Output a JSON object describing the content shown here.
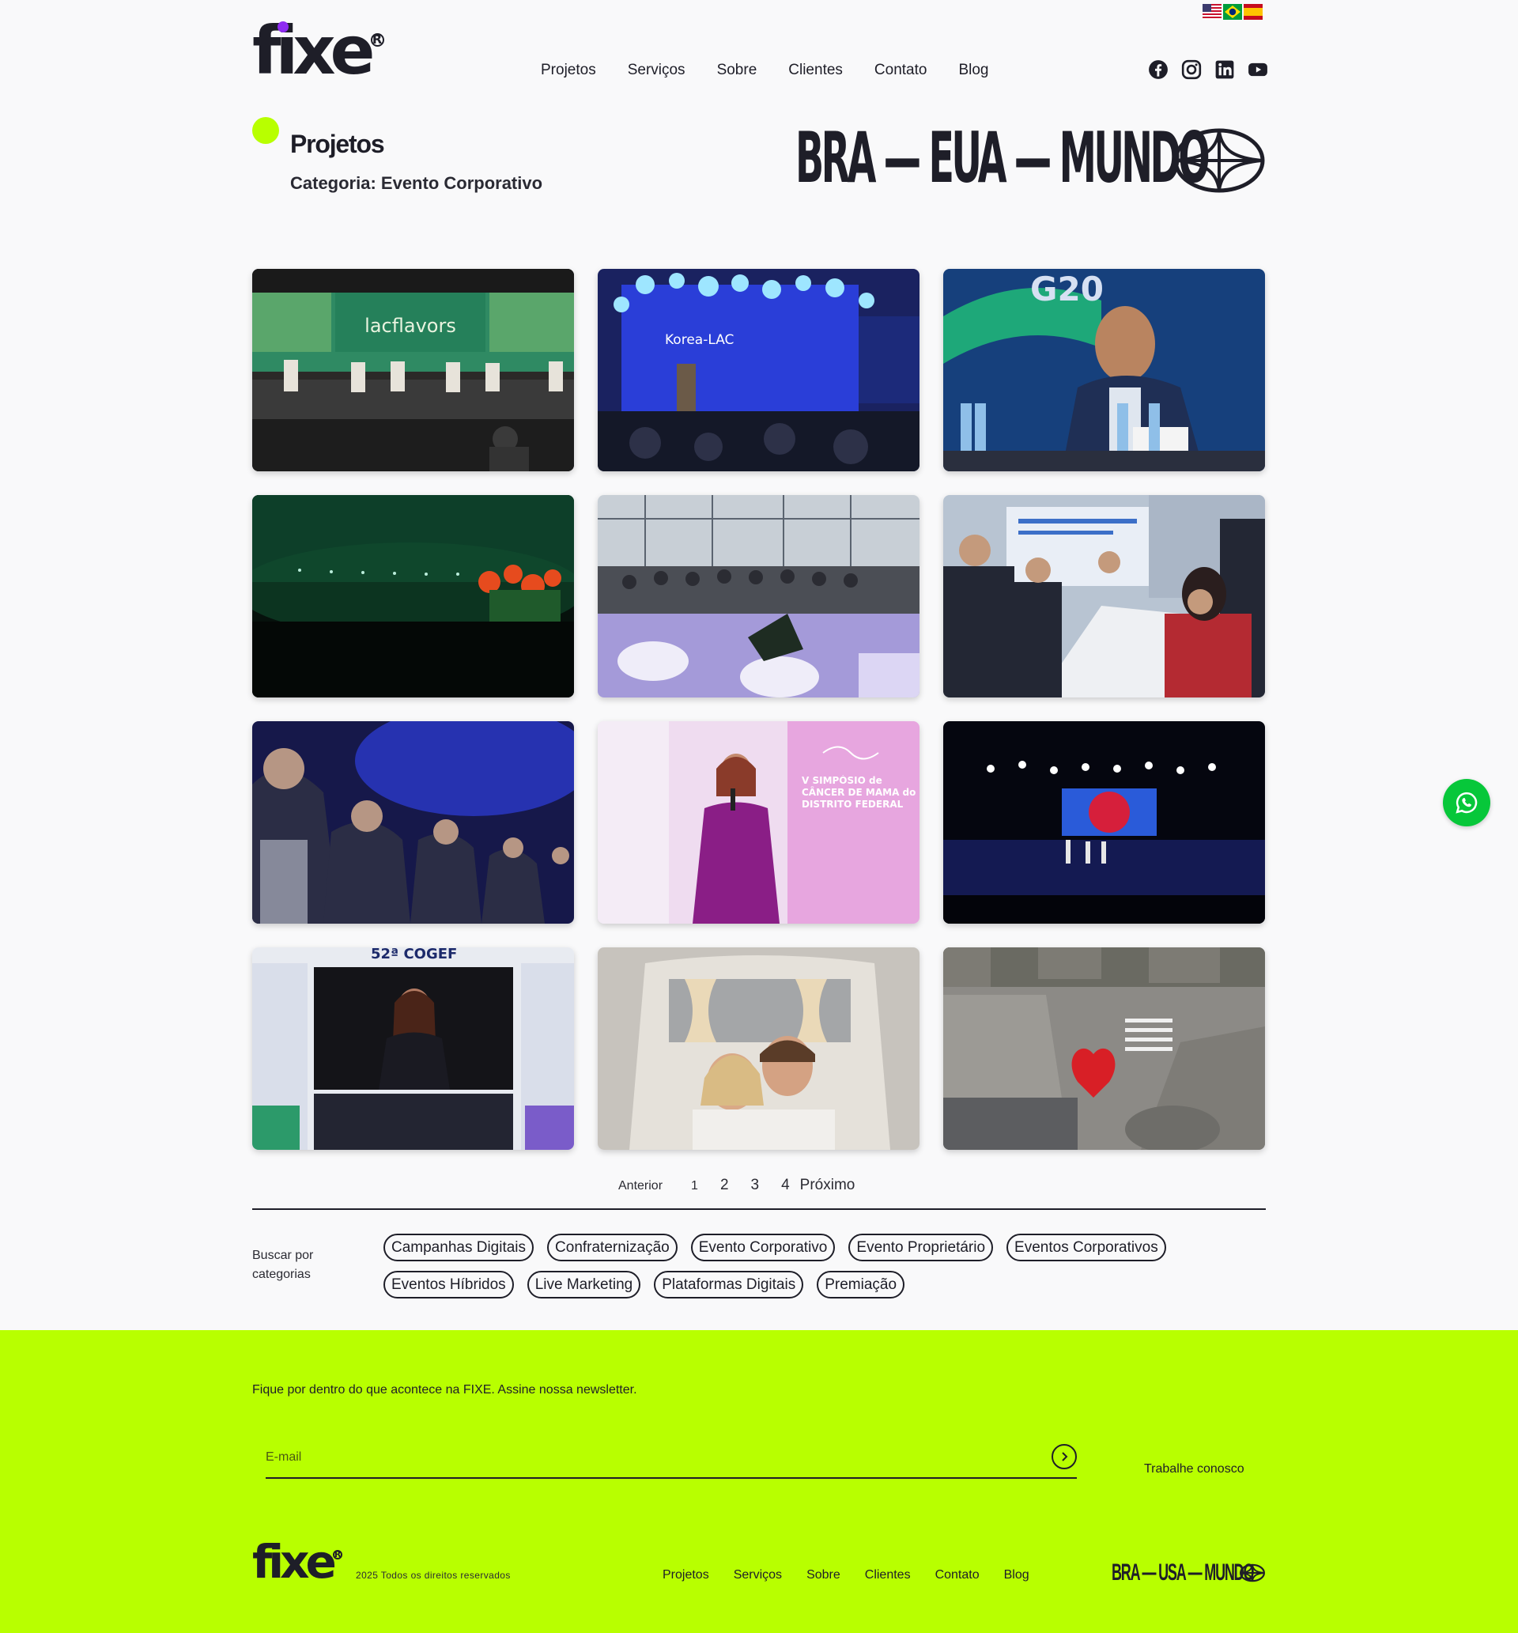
{
  "header": {
    "language_flags": [
      "us-flag-icon",
      "brazil-flag-icon",
      "spain-flag-icon"
    ],
    "logo_text": "fixe",
    "nav": [
      "Projetos",
      "Serviços",
      "Sobre",
      "Clientes",
      "Contato",
      "Blog"
    ],
    "social_icons": [
      "facebook-icon",
      "instagram-icon",
      "linkedin-icon",
      "youtube-icon"
    ]
  },
  "hero": {
    "title": "Projetos",
    "category_line": "Categoria: Evento Corporativo",
    "tagline": "BRA — EUA — MUNDO"
  },
  "projects": [
    {
      "name": "lacflavors-panel-photo",
      "caption_in_image": "lacflavors"
    },
    {
      "name": "korea-lac-stage-photo",
      "caption_in_image": "Korea-LAC"
    },
    {
      "name": "g20-speaker-photo",
      "caption_in_image": "G20"
    },
    {
      "name": "green-lit-auditorium-photo"
    },
    {
      "name": "roundtable-lounge-photo"
    },
    {
      "name": "meeting-table-photo"
    },
    {
      "name": "audience-blue-light-photo"
    },
    {
      "name": "simposio-speaker-photo",
      "caption_in_image": "V SIMPÓSIO de CÂNCER DE MAMA do DISTRITO FEDERAL"
    },
    {
      "name": "dark-stage-screen-photo"
    },
    {
      "name": "cogef-bid-screen-photo",
      "caption_in_image": "52ª COGEF"
    },
    {
      "name": "couple-in-van-photo"
    },
    {
      "name": "street-heart-sculpture-photo"
    }
  ],
  "pagination": {
    "prev": "Anterior",
    "pages": [
      "1",
      "2",
      "3",
      "4"
    ],
    "current": "1",
    "next": "Próximo"
  },
  "categories": {
    "label": "Buscar por categorias",
    "items": [
      "Campanhas Digitais",
      "Confraternização",
      "Evento Corporativo",
      "Evento Proprietário",
      "Eventos Corporativos",
      "Eventos Híbridos",
      "Live Marketing",
      "Plataformas Digitais",
      "Premiação"
    ]
  },
  "whatsapp": {
    "icon": "whatsapp-icon"
  },
  "footer": {
    "newsletter_text": "Fique por dentro do que acontece na FIXE. Assine nossa newsletter.",
    "email_placeholder": "E-mail",
    "careers_link": "Trabalhe conosco",
    "logo_text": "fixe",
    "copyright": "2025 Todos os direitos reservados",
    "nav": [
      "Projetos",
      "Serviços",
      "Sobre",
      "Clientes",
      "Contato",
      "Blog"
    ],
    "tagline": "BRA — USA — MUNDO"
  },
  "colors": {
    "accent_lime": "#b8ff00",
    "text_dark": "#1e1e28",
    "whatsapp_green": "#07c73a",
    "logo_dot_purple": "#8e2bf0"
  }
}
